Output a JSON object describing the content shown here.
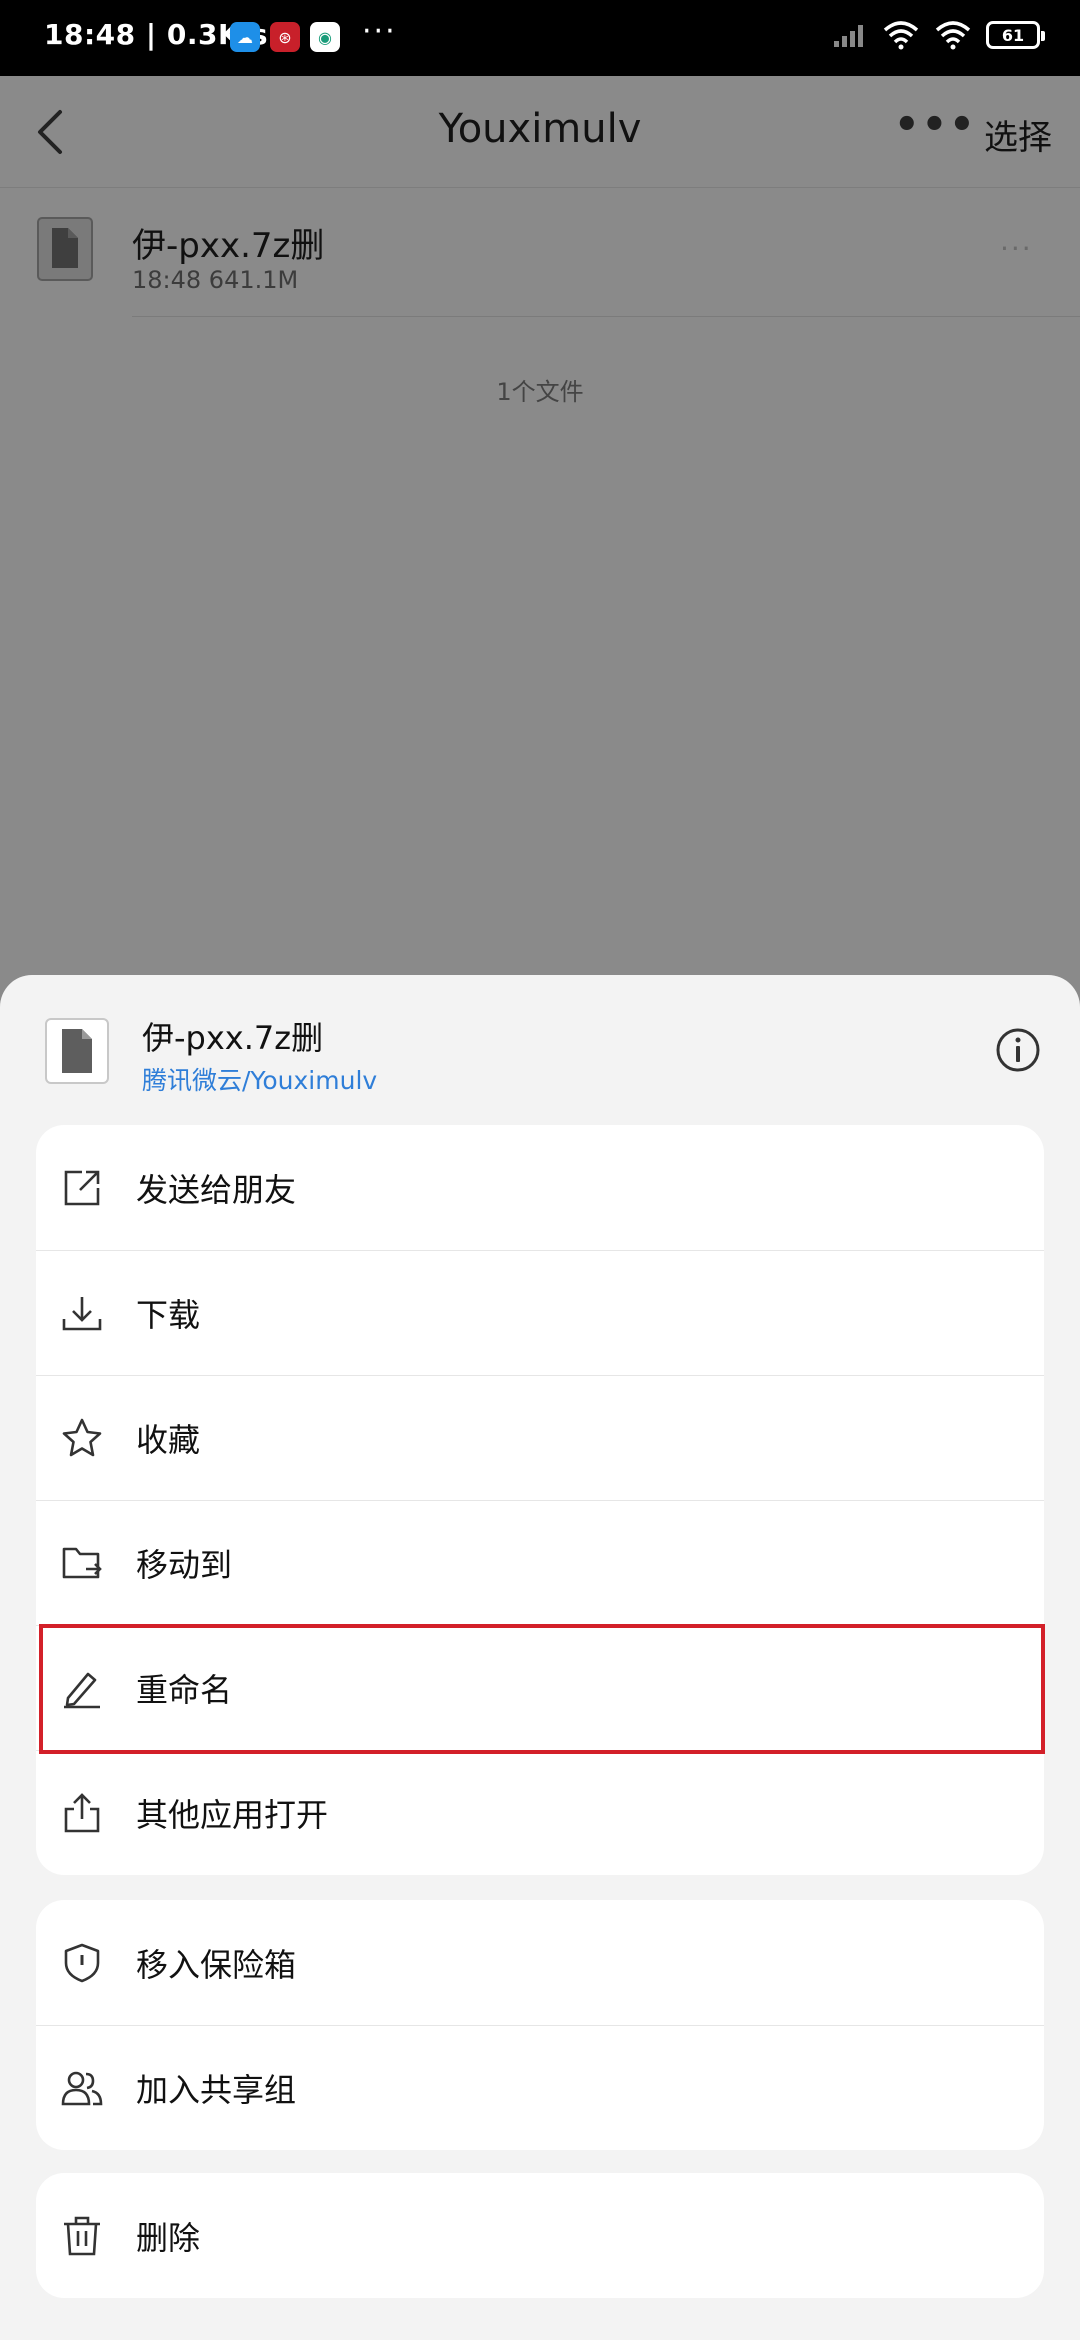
{
  "status_bar": {
    "time_speed": "18:48 | 0.3K/s",
    "more": "···",
    "battery": "61"
  },
  "nav": {
    "title": "Youximulv",
    "more": "•••",
    "select": "选择"
  },
  "file": {
    "name": "伊-pxx.7z删",
    "meta": "18:48  641.1M",
    "more": "···"
  },
  "file_count": "1个文件",
  "sheet": {
    "file_name": "伊-pxx.7z删",
    "file_path": "腾讯微云/Youximulv"
  },
  "menu_group_1": [
    {
      "label": "发送给朋友",
      "icon": "share-icon"
    },
    {
      "label": "下载",
      "icon": "download-icon"
    },
    {
      "label": "收藏",
      "icon": "star-icon"
    },
    {
      "label": "移动到",
      "icon": "move-folder-icon"
    },
    {
      "label": "重命名",
      "icon": "rename-pencil-icon"
    },
    {
      "label": "其他应用打开",
      "icon": "open-with-icon"
    }
  ],
  "menu_group_2": [
    {
      "label": "移入保险箱",
      "icon": "safe-shield-icon"
    },
    {
      "label": "加入共享组",
      "icon": "share-group-icon"
    }
  ],
  "menu_group_3": [
    {
      "label": "删除",
      "icon": "trash-icon"
    }
  ],
  "colors": {
    "overlay": "#8a8a8a",
    "link_blue": "#2f7ed8",
    "highlight_red": "#d32029"
  }
}
